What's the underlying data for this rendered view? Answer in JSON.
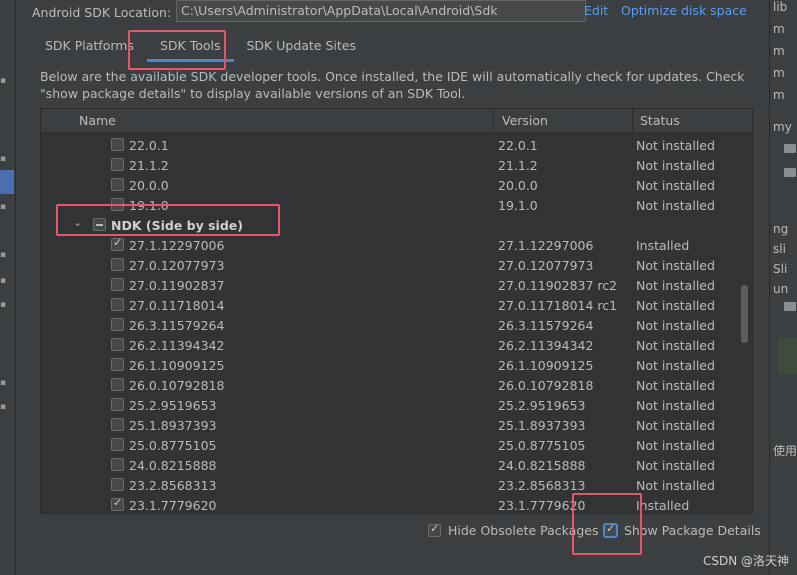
{
  "sdk_location": {
    "label": "Android SDK Location:",
    "path": "C:\\Users\\Administrator\\AppData\\Local\\Android\\Sdk",
    "edit_link": "Edit",
    "optimize_link": "Optimize disk space"
  },
  "tabs": [
    {
      "label": "SDK Platforms",
      "active": false
    },
    {
      "label": "SDK Tools",
      "active": true
    },
    {
      "label": "SDK Update Sites",
      "active": false
    }
  ],
  "description": "Below are the available SDK developer tools. Once installed, the IDE will automatically check for updates. Check \"show package details\" to display available versions of an SDK Tool.",
  "table": {
    "columns": [
      "Name",
      "Version",
      "Status"
    ],
    "rows": [
      {
        "name": "22.0.1",
        "version": "22.0.1",
        "status": "Not installed",
        "checked": false
      },
      {
        "name": "21.1.2",
        "version": "21.1.2",
        "status": "Not installed",
        "checked": false
      },
      {
        "name": "20.0.0",
        "version": "20.0.0",
        "status": "Not installed",
        "checked": false
      },
      {
        "name": "19.1.0",
        "version": "19.1.0",
        "status": "Not installed",
        "checked": false
      },
      {
        "name": "NDK (Side by side)",
        "version": "",
        "status": "",
        "checked": false,
        "group": true
      },
      {
        "name": "27.1.12297006",
        "version": "27.1.12297006",
        "status": "Installed",
        "checked": true
      },
      {
        "name": "27.0.12077973",
        "version": "27.0.12077973",
        "status": "Not installed",
        "checked": false
      },
      {
        "name": "27.0.11902837",
        "version": "27.0.11902837 rc2",
        "status": "Not installed",
        "checked": false
      },
      {
        "name": "27.0.11718014",
        "version": "27.0.11718014 rc1",
        "status": "Not installed",
        "checked": false
      },
      {
        "name": "26.3.11579264",
        "version": "26.3.11579264",
        "status": "Not installed",
        "checked": false
      },
      {
        "name": "26.2.11394342",
        "version": "26.2.11394342",
        "status": "Not installed",
        "checked": false
      },
      {
        "name": "26.1.10909125",
        "version": "26.1.10909125",
        "status": "Not installed",
        "checked": false
      },
      {
        "name": "26.0.10792818",
        "version": "26.0.10792818",
        "status": "Not installed",
        "checked": false
      },
      {
        "name": "25.2.9519653",
        "version": "25.2.9519653",
        "status": "Not installed",
        "checked": false
      },
      {
        "name": "25.1.8937393",
        "version": "25.1.8937393",
        "status": "Not installed",
        "checked": false
      },
      {
        "name": "25.0.8775105",
        "version": "25.0.8775105",
        "status": "Not installed",
        "checked": false
      },
      {
        "name": "24.0.8215888",
        "version": "24.0.8215888",
        "status": "Not installed",
        "checked": false
      },
      {
        "name": "23.2.8568313",
        "version": "23.2.8568313",
        "status": "Not installed",
        "checked": false
      },
      {
        "name": "23.1.7779620",
        "version": "23.1.7779620",
        "status": "Installed",
        "checked": true
      }
    ]
  },
  "footer": {
    "hide_obsolete": {
      "label": "Hide Obsolete Packages",
      "checked": true
    },
    "show_details": {
      "label": "Show Package Details",
      "checked": true
    }
  },
  "right_panel": [
    "lib",
    "m",
    "m",
    "m",
    "m",
    "my",
    "ng",
    "sli",
    "Sli",
    "un"
  ],
  "right_panel_extra": "使用",
  "watermark": "CSDN @洛天神",
  "colors": {
    "highlight": "#e8546a",
    "accent": "#4a88c7",
    "link": "#589df6"
  }
}
